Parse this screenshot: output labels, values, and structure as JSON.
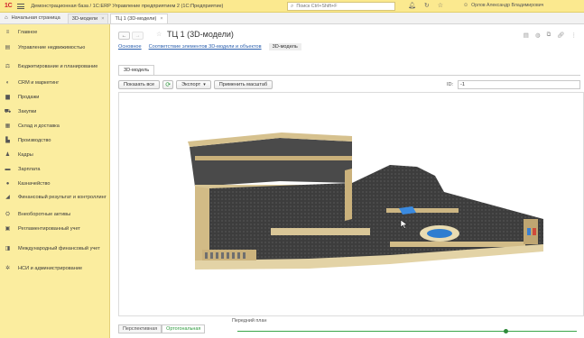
{
  "titlebar": {
    "logo": "1С",
    "title": "Демонстрационная база / 1С:ERP Управление предприятием 2  (1С:Предприятие)",
    "search_placeholder": "Поиск Ctrl+Shift+F",
    "user": "Орлов Александр Владимирович"
  },
  "tabs": {
    "home": "Начальная страница",
    "items": [
      {
        "label": "3D-модели"
      },
      {
        "label": "ТЦ 1 (3D-модели)"
      }
    ]
  },
  "sidebar": {
    "items": [
      {
        "label": "Главное",
        "icon": "menu-icon"
      },
      {
        "label": "Управление недвижимостью",
        "icon": "building-icon"
      },
      {
        "label": "Бюджетирование и планирование",
        "icon": "chart-icon"
      },
      {
        "label": "CRM и маркетинг",
        "icon": "crm-icon"
      },
      {
        "label": "Продажи",
        "icon": "bag-icon"
      },
      {
        "label": "Закупки",
        "icon": "cart-icon"
      },
      {
        "label": "Склад и доставка",
        "icon": "warehouse-icon"
      },
      {
        "label": "Производство",
        "icon": "factory-icon"
      },
      {
        "label": "Кадры",
        "icon": "person-icon"
      },
      {
        "label": "Зарплата",
        "icon": "wallet-icon"
      },
      {
        "label": "Казначейство",
        "icon": "coin-icon"
      },
      {
        "label": "Финансовый результат и контроллинг",
        "icon": "finance-icon"
      },
      {
        "label": "Внеоборотные активы",
        "icon": "assets-icon"
      },
      {
        "label": "Регламентированный учет",
        "icon": "ledger-icon"
      },
      {
        "label": "Международный финансовый учет",
        "icon": "globe-icon"
      },
      {
        "label": "НСИ и администрирование",
        "icon": "gear-icon"
      }
    ]
  },
  "main": {
    "title": "ТЦ 1 (3D-модели)",
    "subtabs": [
      {
        "label": "Основное"
      },
      {
        "label": "Соответствие элементов 3D-модели и объектов"
      },
      {
        "label": "3D-модель"
      }
    ],
    "form_tab": "3D-модель",
    "toolbar": {
      "show_all": "Показать все",
      "export": "Экспорт",
      "apply_scale": "Применить масштаб"
    },
    "id_label": "ID:",
    "id_value": "-1",
    "view_modes": [
      {
        "label": "Перспективная"
      },
      {
        "label": "Ортогональная"
      }
    ],
    "slider": {
      "label": "Передний план",
      "value": 0.79
    }
  }
}
